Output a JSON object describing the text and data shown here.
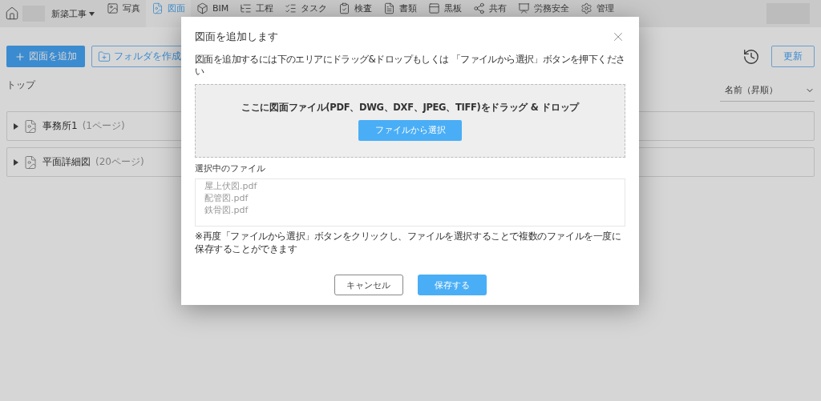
{
  "nav": {
    "project": "新築工事",
    "items": [
      {
        "label": "写真",
        "selected": false
      },
      {
        "label": "図面",
        "selected": true
      },
      {
        "label": "BIM",
        "selected": false
      },
      {
        "label": "工程",
        "selected": false
      },
      {
        "label": "タスク",
        "selected": false
      },
      {
        "label": "検査",
        "selected": false
      },
      {
        "label": "書類",
        "selected": false
      },
      {
        "label": "黒板",
        "selected": false
      },
      {
        "label": "共有",
        "selected": false
      },
      {
        "label": "労務安全",
        "selected": false
      },
      {
        "label": "管理",
        "selected": false
      }
    ]
  },
  "toolbar": {
    "add_button": "図面を追加",
    "folder_button": "フォルダを作成",
    "refresh_button": "更新"
  },
  "breadcrumb": "トップ",
  "sort": {
    "value": "名前（昇順）"
  },
  "folders": [
    {
      "name": "事務所1",
      "pages": "(1ページ)",
      "expanded": false
    },
    {
      "name": "平面詳細図",
      "pages": "(20ページ)",
      "expanded": false
    }
  ],
  "dialog": {
    "title": "図面を追加します",
    "instruction": "図面を追加するには下のエリアにドラッグ&ドロップもしくは 「ファイルから選択」ボタンを押下ください",
    "dropzone_text": "ここに図面ファイル(PDF、DWG、DXF、JPEG、TIFF)をドラッグ & ドロップ",
    "select_button": "ファイルから選択",
    "files_label": "選択中のファイル",
    "files": [
      "屋上伏図.pdf",
      "配管図.pdf",
      "鉄骨図.pdf"
    ],
    "note": "※再度「ファイルから選択」ボタンをクリックし、ファイルを選択することで複数のファイルを一度に保存することができます",
    "cancel_button": "キャンセル",
    "save_button": "保存する"
  }
}
